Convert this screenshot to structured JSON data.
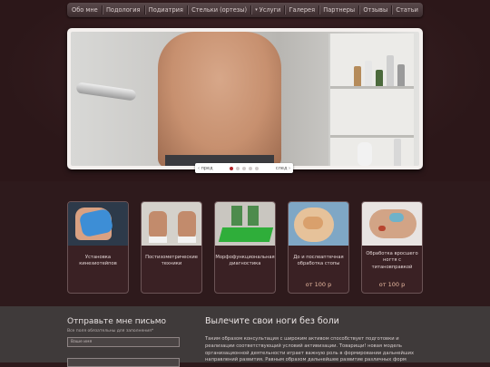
{
  "nav": {
    "items": [
      "Обо мне",
      "Подология",
      "Подиатрия",
      "Стельки (ортезы)",
      "Услуги",
      "Галерея",
      "Партнеры",
      "Отзывы",
      "Статьи"
    ]
  },
  "slider": {
    "prev_label": "пред",
    "next_label": "след",
    "dot_count": 5,
    "active_dot": 0
  },
  "cards": [
    {
      "caption": "Установка кинезиотейпов",
      "price": ""
    },
    {
      "caption": "Постизометрические техники",
      "price": ""
    },
    {
      "caption": "Морфофункциональная диагностика",
      "price": ""
    },
    {
      "caption": "До и послеаптечная обработка стопы",
      "price": "от 100 р"
    },
    {
      "caption": "Обработка вросшего ногтя с титановправкой",
      "price": "от 100 р"
    }
  ],
  "contact": {
    "title": "Отправьте мне письмо",
    "note": "Все поля обязательны для заполнения*",
    "name_placeholder": "Ваше имя"
  },
  "article": {
    "title": "Вылечите свои ноги без боли",
    "text": "Таким образом консультация с широким активом способствует подготовки и реализации соответствующий условий активизации. Товарищи! новая модель организационной деятельности играет важную роль в формировании дальнейших направлений развития. Равным образом дальнейшее развитие различных форм"
  },
  "colors": {
    "background": "#2e1a1c",
    "footer": "#3f3a3a",
    "accent_dot": "#b3262c",
    "price": "#e8b9a0"
  }
}
